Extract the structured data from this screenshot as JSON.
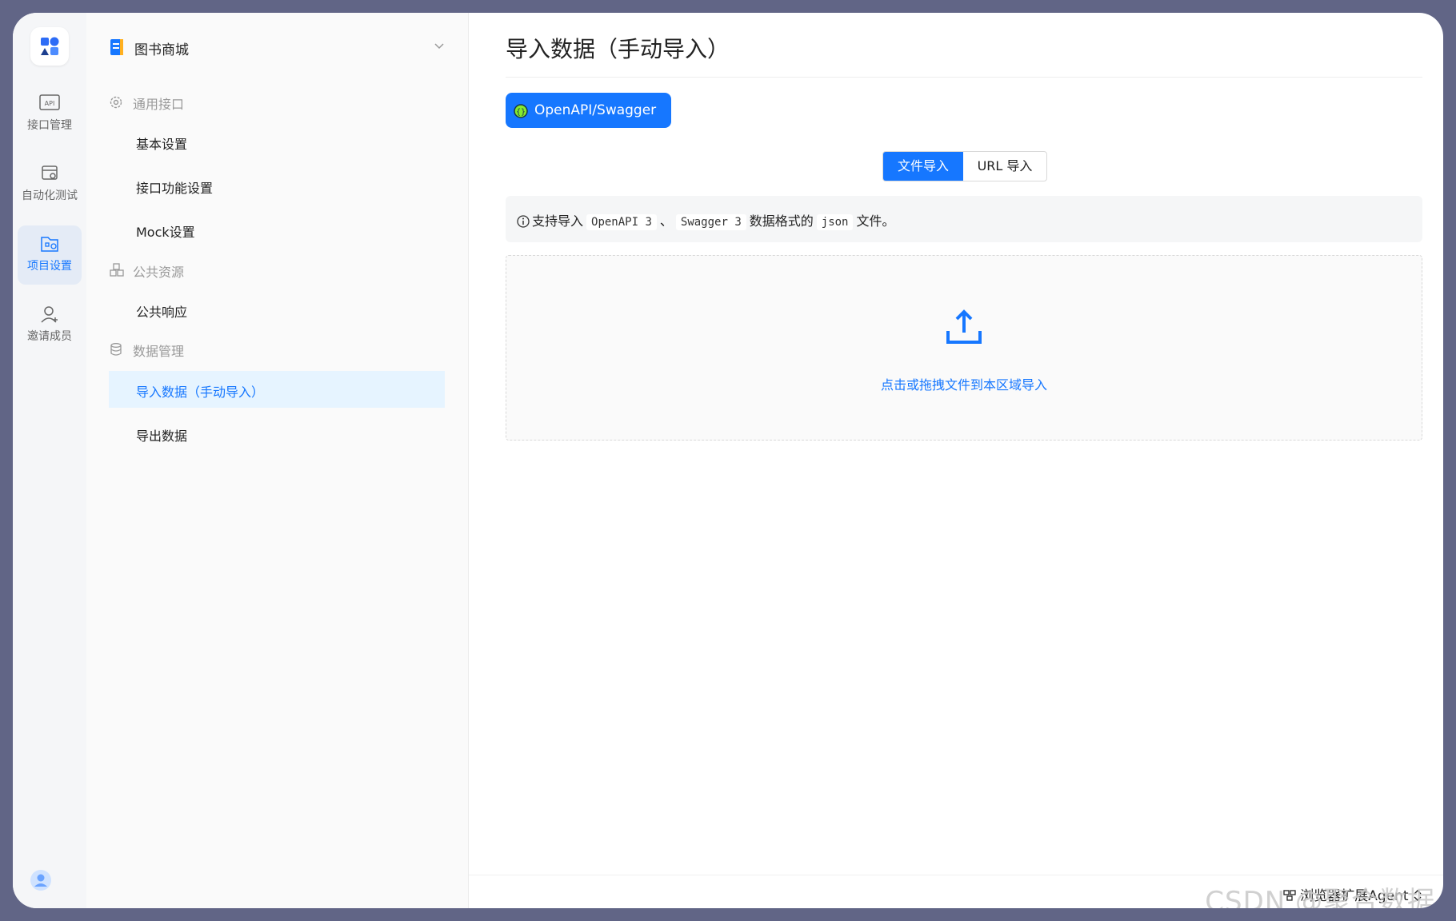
{
  "rail": {
    "items": [
      {
        "label": "接口管理",
        "icon": "api-icon"
      },
      {
        "label": "自动化测试",
        "icon": "automation-icon"
      },
      {
        "label": "项目设置",
        "icon": "project-settings-icon",
        "active": true
      },
      {
        "label": "邀请成员",
        "icon": "invite-member-icon"
      }
    ]
  },
  "sidebar": {
    "project_name": "图书商城",
    "groups": {
      "general": "通用接口",
      "resources": "公共资源",
      "data": "数据管理"
    },
    "items": {
      "basic": "基本设置",
      "api_features": "接口功能设置",
      "mock": "Mock设置",
      "public_response": "公共响应",
      "import": "导入数据（手动导入）",
      "export": "导出数据"
    }
  },
  "main": {
    "title": "导入数据（手动导入）",
    "source_button": "OpenAPI/Swagger",
    "tabs": {
      "file": "文件导入",
      "url": "URL 导入"
    },
    "info": {
      "prefix": "支持导入",
      "fmt1": "OpenAPI 3",
      "sep": "、",
      "fmt2": "Swagger 3",
      "middle": "数据格式的",
      "fmt3": "json",
      "suffix": "文件。"
    },
    "upload_text": "点击或拖拽文件到本区域导入",
    "agent_label": "浏览器扩展Agent"
  },
  "watermark": "CSDN @聚合数据",
  "colors": {
    "accent": "#1677ff",
    "frame": "#616586",
    "active_bg": "#e6f4ff"
  }
}
